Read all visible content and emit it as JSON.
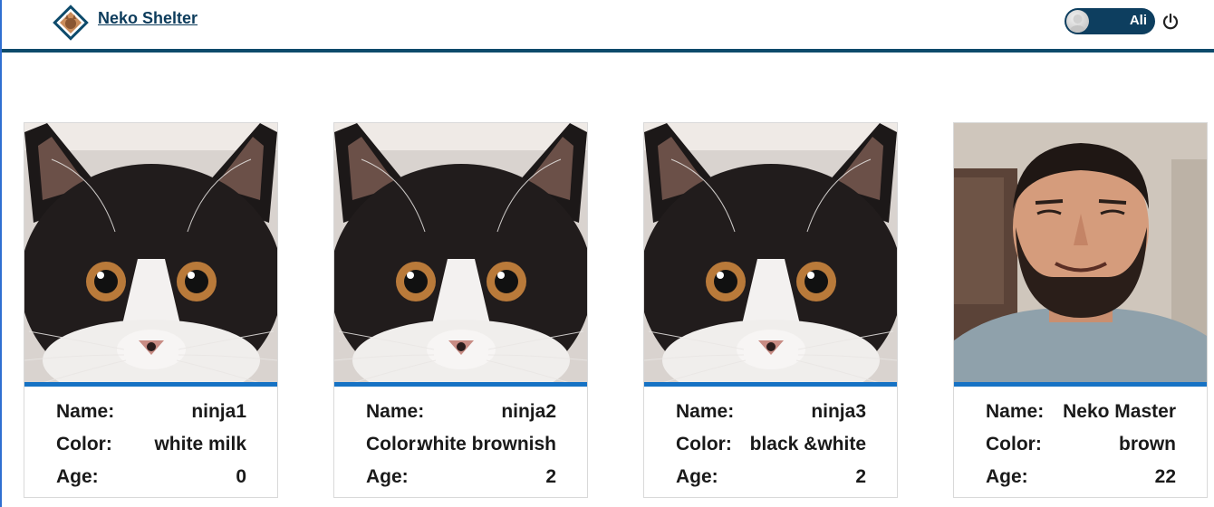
{
  "header": {
    "brand": "Neko Shelter",
    "user_name": "Ali",
    "logo_icon": "cat-diamond-logo-icon",
    "power_icon": "power-icon"
  },
  "labels": {
    "name": "Name:",
    "color": "Color:",
    "age": "Age:"
  },
  "cards": [
    {
      "name": "ninja1",
      "color": "white milk",
      "age": "0",
      "image": "black-white-kitten-photo"
    },
    {
      "name": "ninja2",
      "color": "white brownish",
      "age": "2",
      "image": "black-white-kitten-photo"
    },
    {
      "name": "ninja3",
      "color": "black &white",
      "age": "2",
      "image": "black-white-kitten-photo"
    },
    {
      "name": "Neko Master",
      "color": "brown",
      "age": "22",
      "image": "bearded-man-photo"
    }
  ],
  "colors": {
    "header_rule": "#0d4a6b",
    "card_accent": "#1672c4",
    "toggle_bg": "#0d3e5f"
  }
}
